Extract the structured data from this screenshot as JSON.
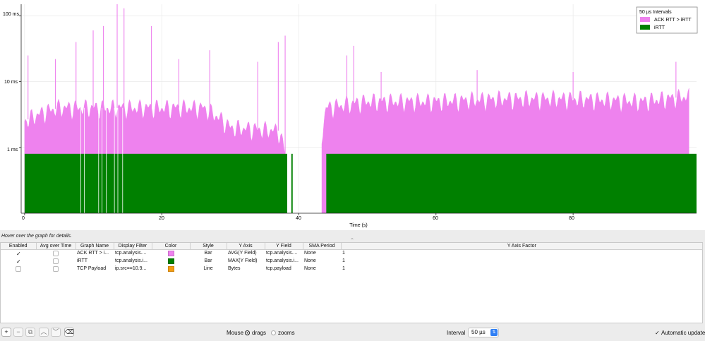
{
  "graph": {
    "y_ticks": [
      "100 ms",
      "10 ms",
      "1 ms"
    ],
    "x_ticks": [
      "0",
      "20",
      "40",
      "60",
      "80"
    ],
    "x_axis_label": "Time (s)",
    "legend": {
      "title": "50 µs Intervals",
      "items": [
        {
          "label": "ACK RTT > iRTT",
          "color": "#ee82ee"
        },
        {
          "label": "iRTT",
          "color": "#008000"
        }
      ]
    }
  },
  "chart_data": {
    "type": "bar",
    "title": "50 µs Intervals",
    "xlabel": "Time (s)",
    "ylabel": "",
    "y_scale": "log",
    "ylim_ms": [
      0.1,
      150
    ],
    "xlim_s": [
      -0.5,
      98
    ],
    "series": [
      {
        "name": "ACK RTT > iRTT",
        "color": "#ee82ee",
        "approx_profile_ms": [
          {
            "x": 0,
            "y": 2.5
          },
          {
            "x": 3,
            "y": 3.5
          },
          {
            "x": 5,
            "y": 4
          },
          {
            "x": 10,
            "y": 4
          },
          {
            "x": 20,
            "y": 4
          },
          {
            "x": 26,
            "y": 4
          },
          {
            "x": 30,
            "y": 2
          },
          {
            "x": 37,
            "y": 1.8
          },
          {
            "x": 38,
            "y": 0.8
          },
          {
            "x": 43,
            "y": 0
          },
          {
            "x": 44,
            "y": 4
          },
          {
            "x": 50,
            "y": 5
          },
          {
            "x": 60,
            "y": 5
          },
          {
            "x": 70,
            "y": 5.5
          },
          {
            "x": 80,
            "y": 5.5
          },
          {
            "x": 90,
            "y": 5
          },
          {
            "x": 97,
            "y": 6
          }
        ],
        "spikes_ms": [
          {
            "x": 0.5,
            "y": 25
          },
          {
            "x": 4.5,
            "y": 22
          },
          {
            "x": 7.5,
            "y": 40
          },
          {
            "x": 10,
            "y": 60
          },
          {
            "x": 11.5,
            "y": 70
          },
          {
            "x": 13.5,
            "y": 150
          },
          {
            "x": 14.5,
            "y": 130
          },
          {
            "x": 18.5,
            "y": 70
          },
          {
            "x": 22.5,
            "y": 22
          },
          {
            "x": 27,
            "y": 30
          },
          {
            "x": 34,
            "y": 20
          },
          {
            "x": 37,
            "y": 40
          },
          {
            "x": 38,
            "y": 50
          },
          {
            "x": 47,
            "y": 25
          },
          {
            "x": 48,
            "y": 35
          },
          {
            "x": 52,
            "y": 14
          },
          {
            "x": 66,
            "y": 15
          },
          {
            "x": 80,
            "y": 14
          },
          {
            "x": 95,
            "y": 20
          }
        ]
      },
      {
        "name": "iRTT",
        "color": "#008000",
        "approx_profile_ms": [
          {
            "x": 0,
            "y": 0.8
          },
          {
            "x": 38.3,
            "y": 0.8
          },
          {
            "x": 38.3,
            "y": 0
          },
          {
            "x": 38.9,
            "y": 0.8
          },
          {
            "x": 43.5,
            "y": 0
          },
          {
            "x": 44,
            "y": 0.8
          },
          {
            "x": 98,
            "y": 0.8
          }
        ]
      }
    ]
  },
  "hint": "Hover over the graph for details.",
  "table": {
    "headers": [
      "Enabled",
      "Avg over Time",
      "Graph Name",
      "Display Filter",
      "Color",
      "Style",
      "Y Axis",
      "Y Field",
      "SMA Period",
      "Y Axis Factor"
    ],
    "rows": [
      {
        "enabled": "✓",
        "name": "ACK RTT > i...",
        "filter": "tcp.analysis....",
        "color": "#ee82ee",
        "style": "Bar",
        "y_axis": "AVG(Y Field)",
        "y_field": "tcp.analysis....",
        "sma": "None",
        "factor": "1"
      },
      {
        "enabled": "✓",
        "name": "iRTT",
        "filter": "tcp.analysis.i...",
        "color": "#008000",
        "style": "Bar",
        "y_axis": "MAX(Y Field)",
        "y_field": "tcp.analysis.i...",
        "sma": "None",
        "factor": "1"
      },
      {
        "enabled": "",
        "name": "TCP Payload",
        "filter": "ip.src==10.9...",
        "color": "#f39c12",
        "style": "Line",
        "y_axis": "Bytes",
        "y_field": "tcp.payload",
        "sma": "None",
        "factor": "1"
      }
    ]
  },
  "toolbar": {
    "add_icon": "plus-icon",
    "remove_icon": "minus-icon",
    "copy_icon": "copy-icon",
    "up_icon": "chevron-up-icon",
    "down_icon": "chevron-down-icon",
    "clear_icon": "clear-list-icon",
    "add": "+",
    "remove": "−",
    "copy": "⧉",
    "up": "︿",
    "down": "﹀",
    "clear": "⌫"
  },
  "mouse": {
    "label": "Mouse",
    "opt_drags": "drags",
    "opt_zooms": "zooms",
    "selected": "drags"
  },
  "interval": {
    "label": "Interval",
    "value": "50 µs"
  },
  "auto_update": {
    "label": "Automatic update",
    "checked": true,
    "check": "✓"
  }
}
